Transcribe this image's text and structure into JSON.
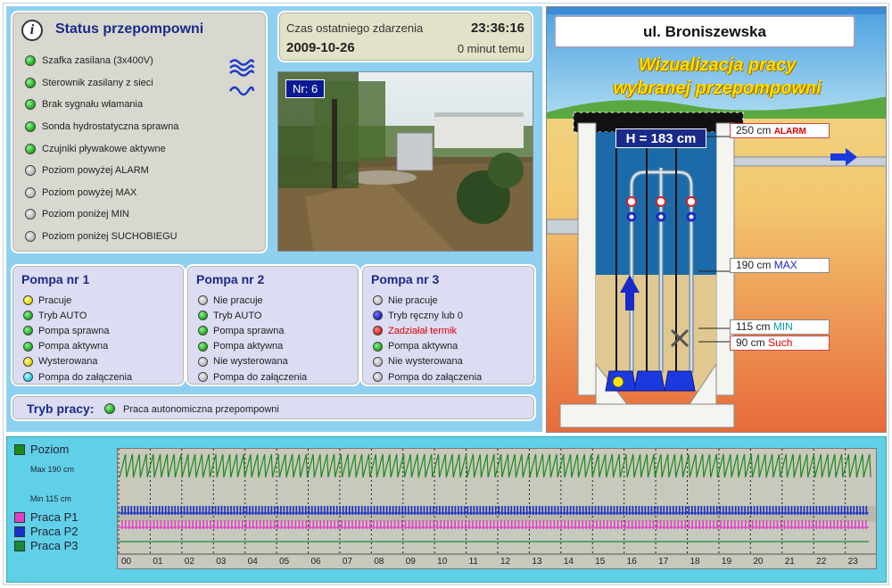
{
  "status": {
    "title": "Status przepompowni",
    "items": [
      {
        "label": "Szafka zasilana (3x400V)",
        "state": "green"
      },
      {
        "label": "Sterownik zasilany z sieci",
        "state": "green"
      },
      {
        "label": "Brak sygnału włamania",
        "state": "green"
      },
      {
        "label": "Sonda hydrostatyczna sprawna",
        "state": "green"
      },
      {
        "label": "Czujniki pływakowe aktywne",
        "state": "green"
      },
      {
        "label": "Poziom powyżej ALARM",
        "state": "off"
      },
      {
        "label": "Poziom powyżej MAX",
        "state": "off"
      },
      {
        "label": "Poziom poniżej MIN",
        "state": "off"
      },
      {
        "label": "Poziom poniżej SUCHOBIEGU",
        "state": "off"
      }
    ]
  },
  "event": {
    "label": "Czas ostatniego zdarzenia",
    "time": "23:36:16",
    "date": "2009-10-26",
    "ago": "0 minut temu"
  },
  "photo": {
    "nr": "Nr: 6"
  },
  "pumps": [
    {
      "title": "Pompa nr 1",
      "items": [
        {
          "label": "Pracuje",
          "state": "yellow"
        },
        {
          "label": "Tryb AUTO",
          "state": "green"
        },
        {
          "label": "Pompa sprawna",
          "state": "green"
        },
        {
          "label": "Pompa aktywna",
          "state": "green"
        },
        {
          "label": "Wysterowana",
          "state": "yellow"
        },
        {
          "label": "Pompa do załączenia",
          "state": "cyan"
        }
      ]
    },
    {
      "title": "Pompa nr 2",
      "items": [
        {
          "label": "Nie pracuje",
          "state": "off"
        },
        {
          "label": "Tryb AUTO",
          "state": "green"
        },
        {
          "label": "Pompa sprawna",
          "state": "green"
        },
        {
          "label": "Pompa aktywna",
          "state": "green"
        },
        {
          "label": "Nie wysterowana",
          "state": "off"
        },
        {
          "label": "Pompa do załączenia",
          "state": "off"
        }
      ]
    },
    {
      "title": "Pompa nr 3",
      "items": [
        {
          "label": "Nie pracuje",
          "state": "off"
        },
        {
          "label": "Tryb ręczny lub 0",
          "state": "blue"
        },
        {
          "label": "Zadziałał termik",
          "state": "red"
        },
        {
          "label": "Pompa aktywna",
          "state": "green"
        },
        {
          "label": "Nie wysterowana",
          "state": "off"
        },
        {
          "label": "Pompa do załączenia",
          "state": "off"
        }
      ]
    }
  ],
  "mode": {
    "label": "Tryb pracy:",
    "text": "Praca autonomiczna przepompowni"
  },
  "vis": {
    "street": "ul. Broniszewska",
    "headline1": "Wizualizacja pracy",
    "headline2": "wybranej przepompowni",
    "h_value": "H = 183 cm",
    "levels": {
      "alarm": {
        "value": "250 cm",
        "name": "ALARM"
      },
      "max": {
        "value": "190 cm",
        "name": "MAX"
      },
      "min": {
        "value": "115 cm",
        "name": "MIN"
      },
      "such": {
        "value": "90 cm",
        "name": "Such"
      }
    }
  },
  "chart": {
    "legend": {
      "poziom": "Poziom",
      "p1": "Praca P1",
      "p2": "Praca P2",
      "p3": "Praca P3"
    },
    "max_label": "Max 190 cm",
    "min_label": "Min 115 cm",
    "colors": {
      "poziom": "#1a8a1a",
      "p1": "#e040c8",
      "p2": "#1830c8",
      "p3": "#1a8a3a"
    }
  },
  "chart_data": {
    "type": "line",
    "title": "",
    "xlabel": "",
    "ylabel": "",
    "x": [
      "00",
      "01",
      "02",
      "03",
      "04",
      "05",
      "06",
      "07",
      "08",
      "09",
      "10",
      "11",
      "12",
      "13",
      "14",
      "15",
      "16",
      "17",
      "18",
      "19",
      "20",
      "21",
      "22",
      "23"
    ],
    "series": [
      {
        "name": "Poziom",
        "min": 115,
        "max": 190,
        "cycles_per_hour": 4.5
      },
      {
        "name": "Praca P1",
        "cycles_per_hour": 2.5
      },
      {
        "name": "Praca P2",
        "cycles_per_hour": 2.2
      },
      {
        "name": "Praca P3",
        "cycles_per_hour": 0
      }
    ]
  }
}
